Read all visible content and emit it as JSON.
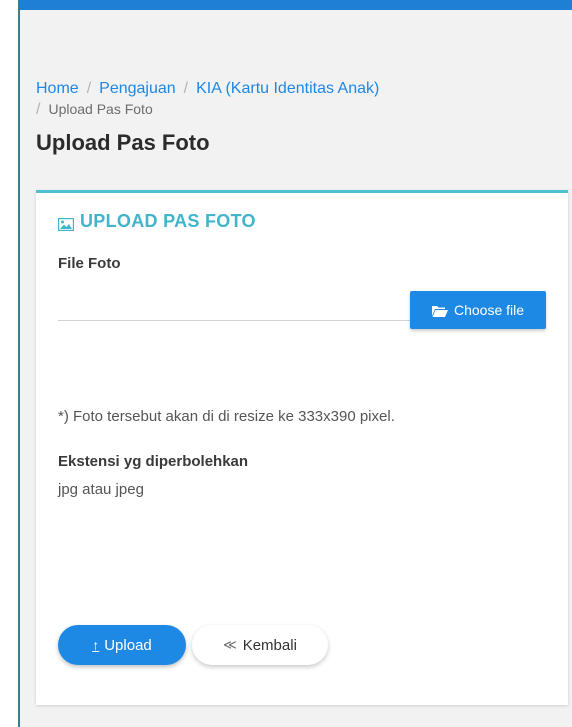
{
  "breadcrumb": {
    "home": "Home",
    "pengajuan": "Pengajuan",
    "kia": "KIA (Kartu Identitas Anak)",
    "current": "Upload Pas Foto",
    "separator": "/"
  },
  "page": {
    "title": "Upload Pas Foto"
  },
  "card": {
    "title": "UPLOAD PAS FOTO",
    "title_icon": "image-icon",
    "field_label": "File Foto",
    "file_value": "",
    "choose_label": "Choose file",
    "choose_icon": "folder-open-icon",
    "note": "*) Foto tersebut akan di di resize ke 333x390 pixel.",
    "ext_label": "Ekstensi yg diperbolehkan",
    "ext_value": "jpg atau jpeg"
  },
  "actions": {
    "upload_label": "Upload",
    "upload_icon": "upload-icon",
    "back_label": "Kembali",
    "back_icon": "double-chevron-left-icon"
  },
  "colors": {
    "primary": "#1e88e5",
    "accent_teal": "#40b5cc",
    "top_bar": "#1e7fd4",
    "background": "#f2f2f2"
  }
}
